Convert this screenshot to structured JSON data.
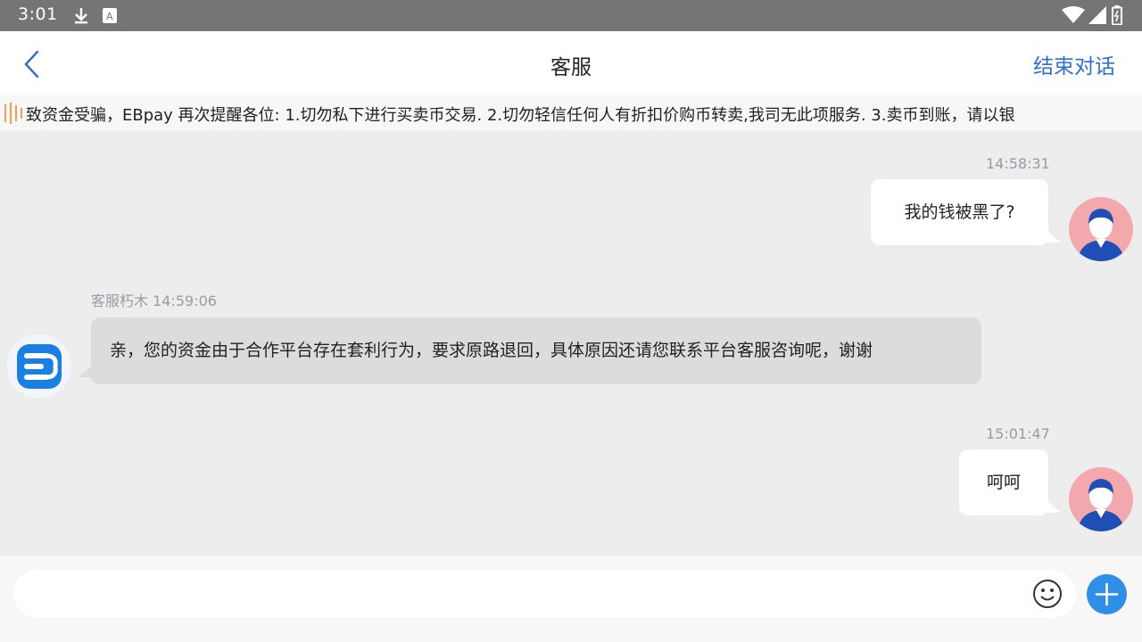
{
  "status_bar": {
    "time": "3:01",
    "icons": [
      "download-icon",
      "keyboard-indicator-icon",
      "wifi-icon",
      "signal-icon",
      "battery-icon"
    ]
  },
  "header": {
    "title": "客服",
    "end_chat_label": "结束对话",
    "accent_color": "#2f6fd1"
  },
  "marquee": {
    "text": "致资金受骗，EBpay 再次提醒各位: 1.切勿私下进行买卖币交易. 2.切勿轻信任何人有折扣价购币转卖,我司无此项服务. 3.卖币到账，请以银"
  },
  "messages": [
    {
      "direction": "out",
      "timestamp": "14:58:31",
      "text": "我的钱被黑了?"
    },
    {
      "direction": "in",
      "sender": "客服朽木",
      "timestamp": "14:59:06",
      "text": "亲，您的资金由于合作平台存在套利行为，要求原路退回，具体原因还请您联系平台客服咨询呢，谢谢"
    },
    {
      "direction": "out",
      "timestamp": "15:01:47",
      "text": "呵呵"
    }
  ],
  "input": {
    "placeholder": "",
    "value": ""
  }
}
